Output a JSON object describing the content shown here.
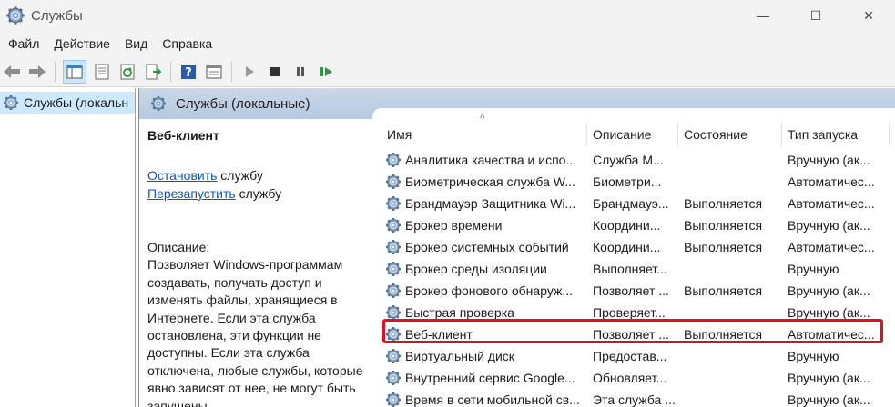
{
  "window": {
    "title": "Службы",
    "icon": "gears-icon",
    "controls": {
      "minimize": "—",
      "maximize": "☐",
      "close": "✕"
    }
  },
  "menu": [
    "Файл",
    "Действие",
    "Вид",
    "Справка"
  ],
  "toolbar": {
    "icons": [
      "back-arrow-icon",
      "forward-arrow-icon",
      "console-tree-icon",
      "properties-icon",
      "refresh-icon",
      "export-list-icon",
      "help-icon",
      "view-icon",
      "start-service-icon",
      "stop-service-icon",
      "pause-service-icon",
      "restart-service-icon"
    ]
  },
  "tree": {
    "item": "Службы (локальн"
  },
  "pane": {
    "header": "Службы (локальные)",
    "description": {
      "title": "Веб-клиент",
      "stop_link": "Остановить",
      "stop_suffix": " службу",
      "restart_link": "Перезапустить",
      "restart_suffix": " службу",
      "body": "Описание:\nПозволяет Windows-программам создавать, получать доступ и изменять файлы, хранящиеся в Интернете. Если эта служба остановлена, эти функции не доступны. Если эта служба отключена, любые службы, которые явно зависят от нее, не могут быть запущены."
    }
  },
  "list": {
    "sort_indicator": "^",
    "columns": [
      "Имя",
      "Описание",
      "Состояние",
      "Тип запуска"
    ],
    "rows": [
      {
        "name": "Аналитика качества и испо...",
        "desc": "Служба M...",
        "state": "",
        "startup": "Вручную (ак..."
      },
      {
        "name": "Биометрическая служба W...",
        "desc": "Биометри...",
        "state": "",
        "startup": "Автоматичес..."
      },
      {
        "name": "Брандмауэр Защитника Wi...",
        "desc": "Брандмауэ...",
        "state": "Выполняется",
        "startup": "Автоматичес..."
      },
      {
        "name": "Брокер времени",
        "desc": "Координи...",
        "state": "Выполняется",
        "startup": "Вручную (ак..."
      },
      {
        "name": "Брокер системных событий",
        "desc": "Координи...",
        "state": "Выполняется",
        "startup": "Автоматичес..."
      },
      {
        "name": "Брокер среды изоляции",
        "desc": "Выполняет...",
        "state": "",
        "startup": "Вручную"
      },
      {
        "name": "Брокер фонового обнаруж...",
        "desc": "Позволяет ...",
        "state": "Выполняется",
        "startup": "Вручную (ак..."
      },
      {
        "name": "Быстрая проверка",
        "desc": "Проверяет...",
        "state": "",
        "startup": "Вручную (ак..."
      },
      {
        "name": "Веб-клиент",
        "desc": "Позволяет ...",
        "state": "Выполняется",
        "startup": "Автоматичес...",
        "selected": true
      },
      {
        "name": "Виртуальный диск",
        "desc": "Предостав...",
        "state": "",
        "startup": "Вручную"
      },
      {
        "name": "Внутренний сервис Google...",
        "desc": "Обновляет...",
        "state": "",
        "startup": "Вручную (ак..."
      },
      {
        "name": "Время в сети мобильной св...",
        "desc": "Эта служба ...",
        "state": "",
        "startup": "Вручную (ак..."
      }
    ]
  },
  "colors": {
    "highlight_border": "#e0101c",
    "link": "#0a56c2",
    "header_bg": "#c9d8ea",
    "tree_selected": "#cde8ff"
  }
}
